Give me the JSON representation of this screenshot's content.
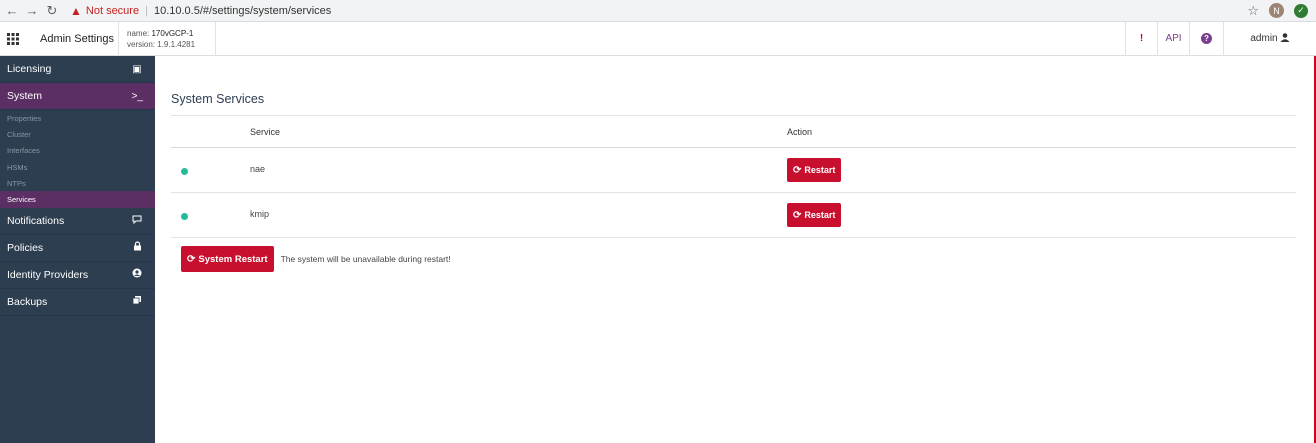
{
  "browser": {
    "security_label": "Not secure",
    "url": "10.10.0.5/#/settings/system/services",
    "profile_initial": "N"
  },
  "header": {
    "app_title": "Admin Settings",
    "node_name_label": "name:",
    "node_name": "170vGCP-1",
    "version_label": "version:",
    "version": "1.9.1.4281",
    "alert": "!",
    "api_label": "API",
    "help_glyph": "?",
    "user": "admin"
  },
  "sidebar": {
    "items": [
      {
        "label": "Licensing",
        "icon": "license-icon",
        "glyph": "▣"
      },
      {
        "label": "System",
        "icon": "terminal-icon",
        "glyph": ">_"
      },
      {
        "label": "Notifications",
        "icon": "chat-icon",
        "glyph": "▭"
      },
      {
        "label": "Policies",
        "icon": "lock-icon",
        "glyph": "🔒"
      },
      {
        "label": "Identity Providers",
        "icon": "user-circle-icon",
        "glyph": "◉"
      },
      {
        "label": "Backups",
        "icon": "copy-icon",
        "glyph": "❐"
      }
    ],
    "system_sub": [
      "Properties",
      "Cluster",
      "Interfaces",
      "HSMs",
      "NTPs",
      "Services"
    ]
  },
  "main": {
    "title": "System Services",
    "columns": {
      "service": "Service",
      "action": "Action"
    },
    "services": [
      {
        "name": "nae",
        "status_color": "#26b99a",
        "action": "Restart"
      },
      {
        "name": "kmip",
        "status_color": "#26b99a",
        "action": "Restart"
      }
    ],
    "system_restart_label": "System Restart",
    "system_restart_warning": "The system will be unavailable during restart!"
  },
  "colors": {
    "sidebar_bg": "#2c3e50",
    "sidebar_active": "#5b2f63",
    "danger": "#c8102e",
    "status_ok": "#26b99a",
    "accent": "#7a3e8f"
  }
}
